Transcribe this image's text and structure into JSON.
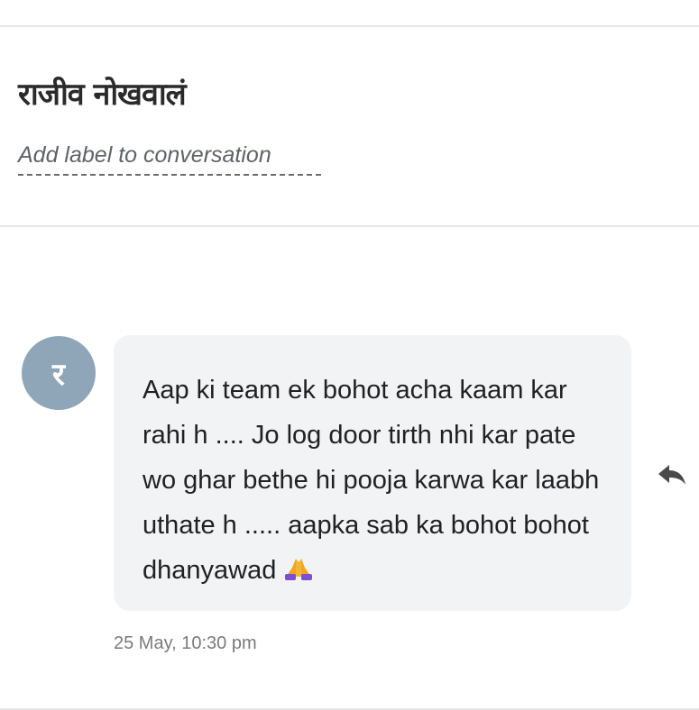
{
  "conversation": {
    "contact_name": "राजीव नोखवालं",
    "add_label_text": "Add label to conversation"
  },
  "message": {
    "avatar_initial": "र",
    "avatar_color": "#8fa6b8",
    "text": "Aap ki team ek bohot acha kaam kar rahi h .... Jo log door tirth nhi kar pate wo ghar bethe hi pooja karwa kar laabh uthate h ..... aapka sab ka bohot bohot dhanyawad",
    "emoji": "folded-hands-emoji",
    "timestamp": "25 May, 10:30 pm",
    "bubble_color": "#f1f3f5"
  },
  "actions": {
    "reply_icon": "reply-icon"
  }
}
